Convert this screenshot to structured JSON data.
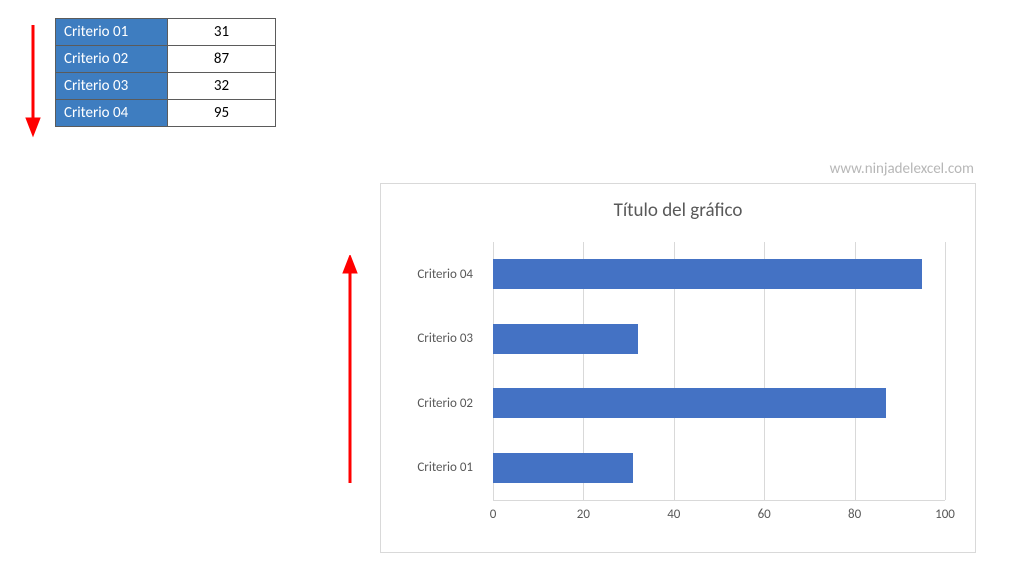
{
  "table": {
    "rows": [
      {
        "label": "Criterio 01",
        "value": 31
      },
      {
        "label": "Criterio 02",
        "value": 87
      },
      {
        "label": "Criterio 03",
        "value": 32
      },
      {
        "label": "Criterio 04",
        "value": 95
      }
    ]
  },
  "watermark": "www.ninjadelexcel.com",
  "chart_data": {
    "type": "bar",
    "orientation": "horizontal",
    "title": "Título del gráfico",
    "categories": [
      "Criterio 01",
      "Criterio 02",
      "Criterio 03",
      "Criterio 04"
    ],
    "values": [
      31,
      87,
      32,
      95
    ],
    "xlabel": "",
    "ylabel": "",
    "xlim": [
      0,
      100
    ],
    "x_ticks": [
      0,
      20,
      40,
      60,
      80,
      100
    ],
    "bar_color": "#4472c4",
    "category_order_on_axis": "reversed",
    "gridlines": true
  },
  "arrows": {
    "table_arrow_direction": "down",
    "chart_arrow_direction": "up",
    "color": "#ff0000"
  }
}
